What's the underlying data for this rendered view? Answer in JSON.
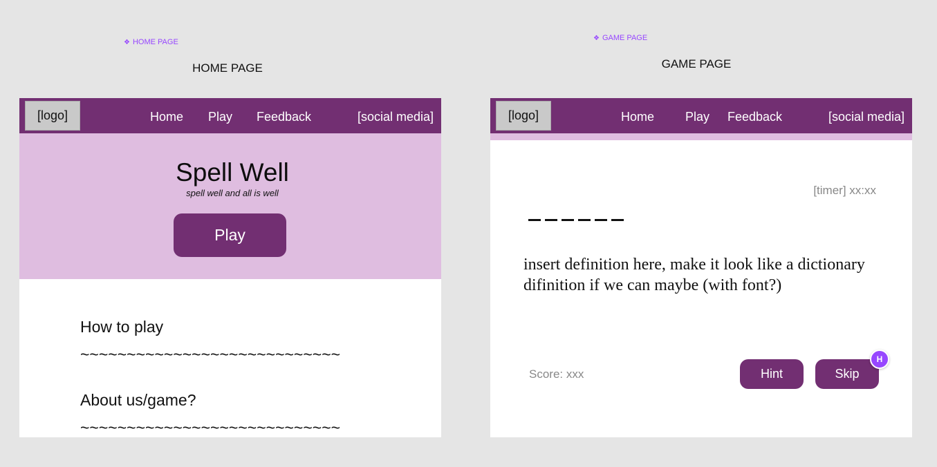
{
  "home": {
    "tag": "HOME PAGE",
    "title": "HOME PAGE",
    "nav": {
      "logo": "[logo]",
      "links": [
        "Home",
        "Play",
        "Feedback"
      ],
      "social": "[social media]"
    },
    "hero": {
      "title": "Spell Well",
      "tagline": "spell well and all is well",
      "play_button": "Play"
    },
    "sections": [
      {
        "heading": "How to play",
        "body": "~~~~~~~~~~~~~~~~~~~~~~~~~~~~"
      },
      {
        "heading": "About us/game?",
        "body": "~~~~~~~~~~~~~~~~~~~~~~~~~~~~"
      }
    ]
  },
  "game": {
    "tag": "GAME PAGE",
    "title": "GAME PAGE",
    "nav": {
      "logo": "[logo]",
      "links": [
        "Home",
        "Play",
        "Feedback"
      ],
      "social": "[social media]"
    },
    "timer": "[timer] xx:xx",
    "blank_count": 6,
    "definition": " insert definition here, make it look like a dictionary difinition if we can maybe (with font?)",
    "score": "Score: xxx",
    "hint_button": "Hint",
    "skip_button": "Skip",
    "avatar_initial": "H"
  },
  "colors": {
    "primary": "#722f72",
    "light": "#dfbde0",
    "frame_tag": "#9747ff"
  },
  "icons": {
    "frame_tag": "component-icon"
  }
}
